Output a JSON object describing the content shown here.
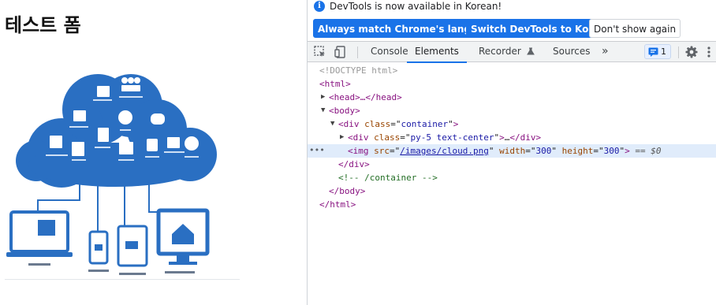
{
  "page": {
    "title": "테스트 폼"
  },
  "devtools": {
    "infobar": {
      "message": "DevTools is now available in Korean!",
      "buttons": [
        "Always match Chrome's language",
        "Switch DevTools to Korean",
        "Don't show again"
      ]
    },
    "tabs": [
      "Console",
      "Elements",
      "Recorder",
      "Sources"
    ],
    "active_tab": "Elements",
    "more_tabs": "»",
    "issues_count": "1",
    "dom": {
      "doctype": "<!DOCTYPE html>",
      "html_open": "<html>",
      "head": "<head>…</head>",
      "body_open": "<body>",
      "div_container_tag": "div",
      "div_container_attr": "class",
      "div_container_val": "container",
      "div_py_attr": "class",
      "div_py_val": "py-5 text-center",
      "ellipsis": "…",
      "img_tag": "img",
      "img_src_attr": "src",
      "img_src_val": "/images/cloud.png",
      "img_width_attr": "width",
      "img_width_val": "300",
      "img_height_attr": "height",
      "img_height_val": "300",
      "selected_marker": "== $0",
      "div_close": "</div>",
      "comment": "<!-- /container -->",
      "body_close": "</body>",
      "html_close": "</html>",
      "selected_dots": "•••"
    }
  },
  "colors": {
    "accent": "#1a73e8",
    "cloud_blue": "#2a6fc2",
    "tag": "#881280",
    "attr": "#994500",
    "value": "#1a1aa6",
    "comment": "#236e25"
  }
}
